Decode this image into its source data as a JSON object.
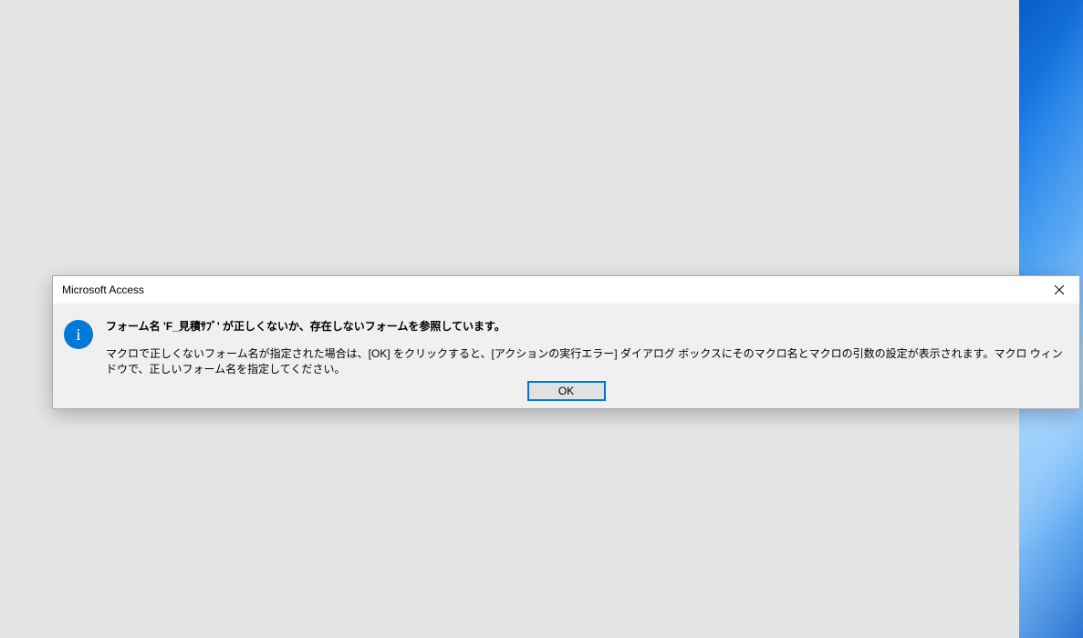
{
  "dialog": {
    "title": "Microsoft Access",
    "main_message": "フォーム名 'F_見積ｻﾌﾞ' が正しくないか、存在しないフォームを参照しています。",
    "detail_message": "マクロで正しくないフォーム名が指定された場合は、[OK] をクリックすると、[アクションの実行エラー] ダイアログ ボックスにそのマクロ名とマクロの引数の設定が表示されます。マクロ ウィンドウで、正しいフォーム名を指定してください。",
    "ok_label": "OK",
    "icon_char": "i"
  }
}
